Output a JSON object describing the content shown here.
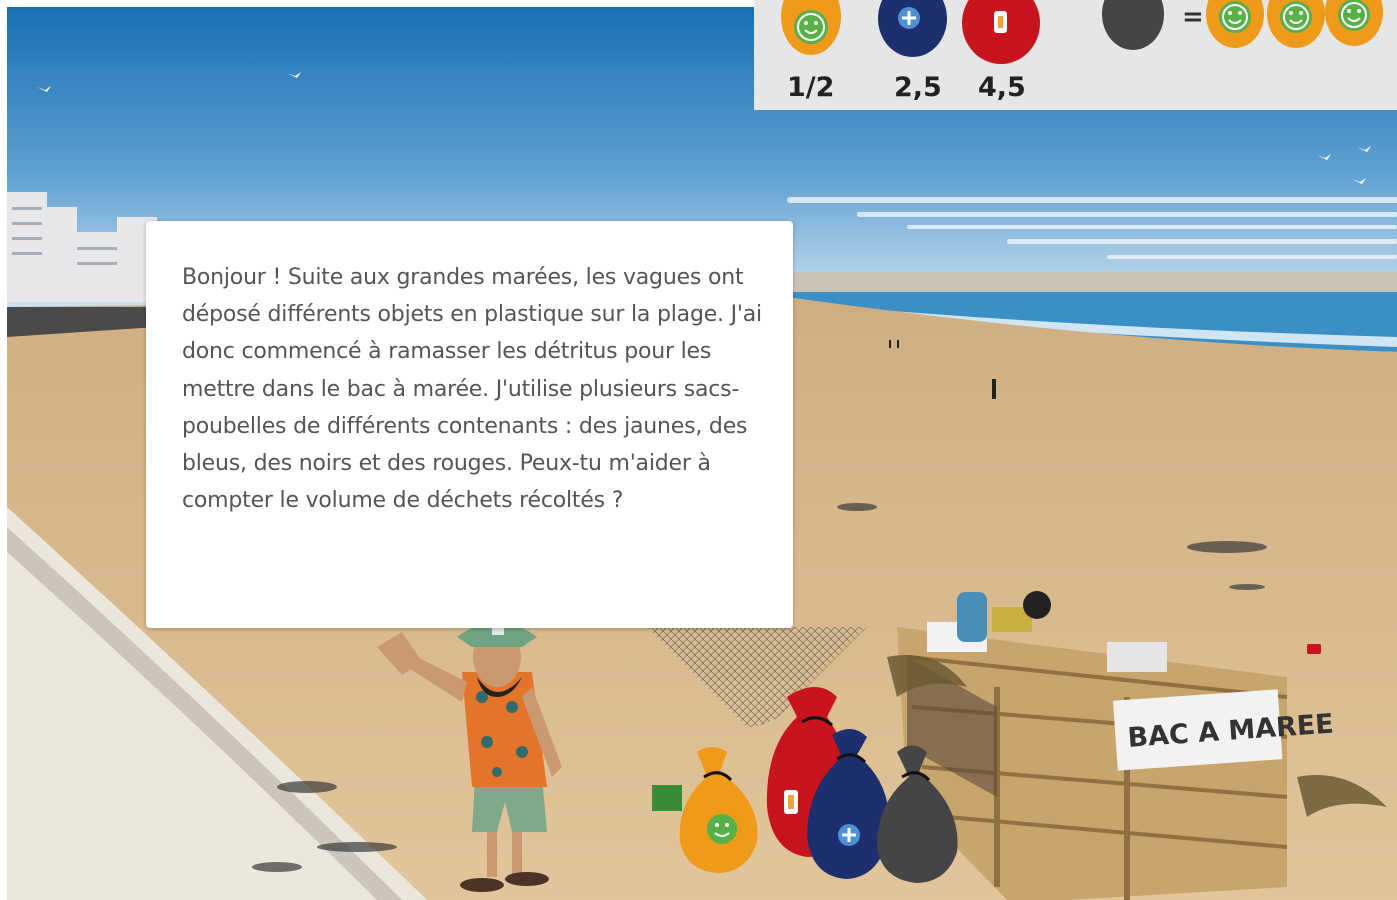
{
  "dialog": {
    "text": "Bonjour ! Suite aux grandes marées, les vagues ont déposé différents objets en plastique sur la plage. J'ai donc commencé à ramasser les détritus pour les mettre dans le bac à marée. J'utilise plusieurs sacs-poubelles de différents contenants : des jaunes, des bleus, des noirs et des rouges. Peux-tu m'aider à compter le volume de déchets récoltés ?"
  },
  "legend": {
    "yellow_value": "1/2",
    "blue_value": "2,5",
    "red_value": "4,5",
    "equals_sign": "=",
    "black_equals_yellow_count": 3
  },
  "bin_sign": "BAC A MAREE",
  "colors": {
    "yellow_bag": "#ef9a1a",
    "blue_bag": "#1d2f6f",
    "red_bag": "#c8141c",
    "black_bag": "#454545",
    "smiley": "#58b048",
    "sky": "#1f76b8",
    "sand": "#d9b98c",
    "sea": "#3b8fc5"
  },
  "icons": [
    "yellow-bag-icon",
    "blue-bag-icon",
    "red-bag-icon",
    "black-bag-icon",
    "smiley-icon",
    "plus-icon",
    "bottle-icon"
  ]
}
